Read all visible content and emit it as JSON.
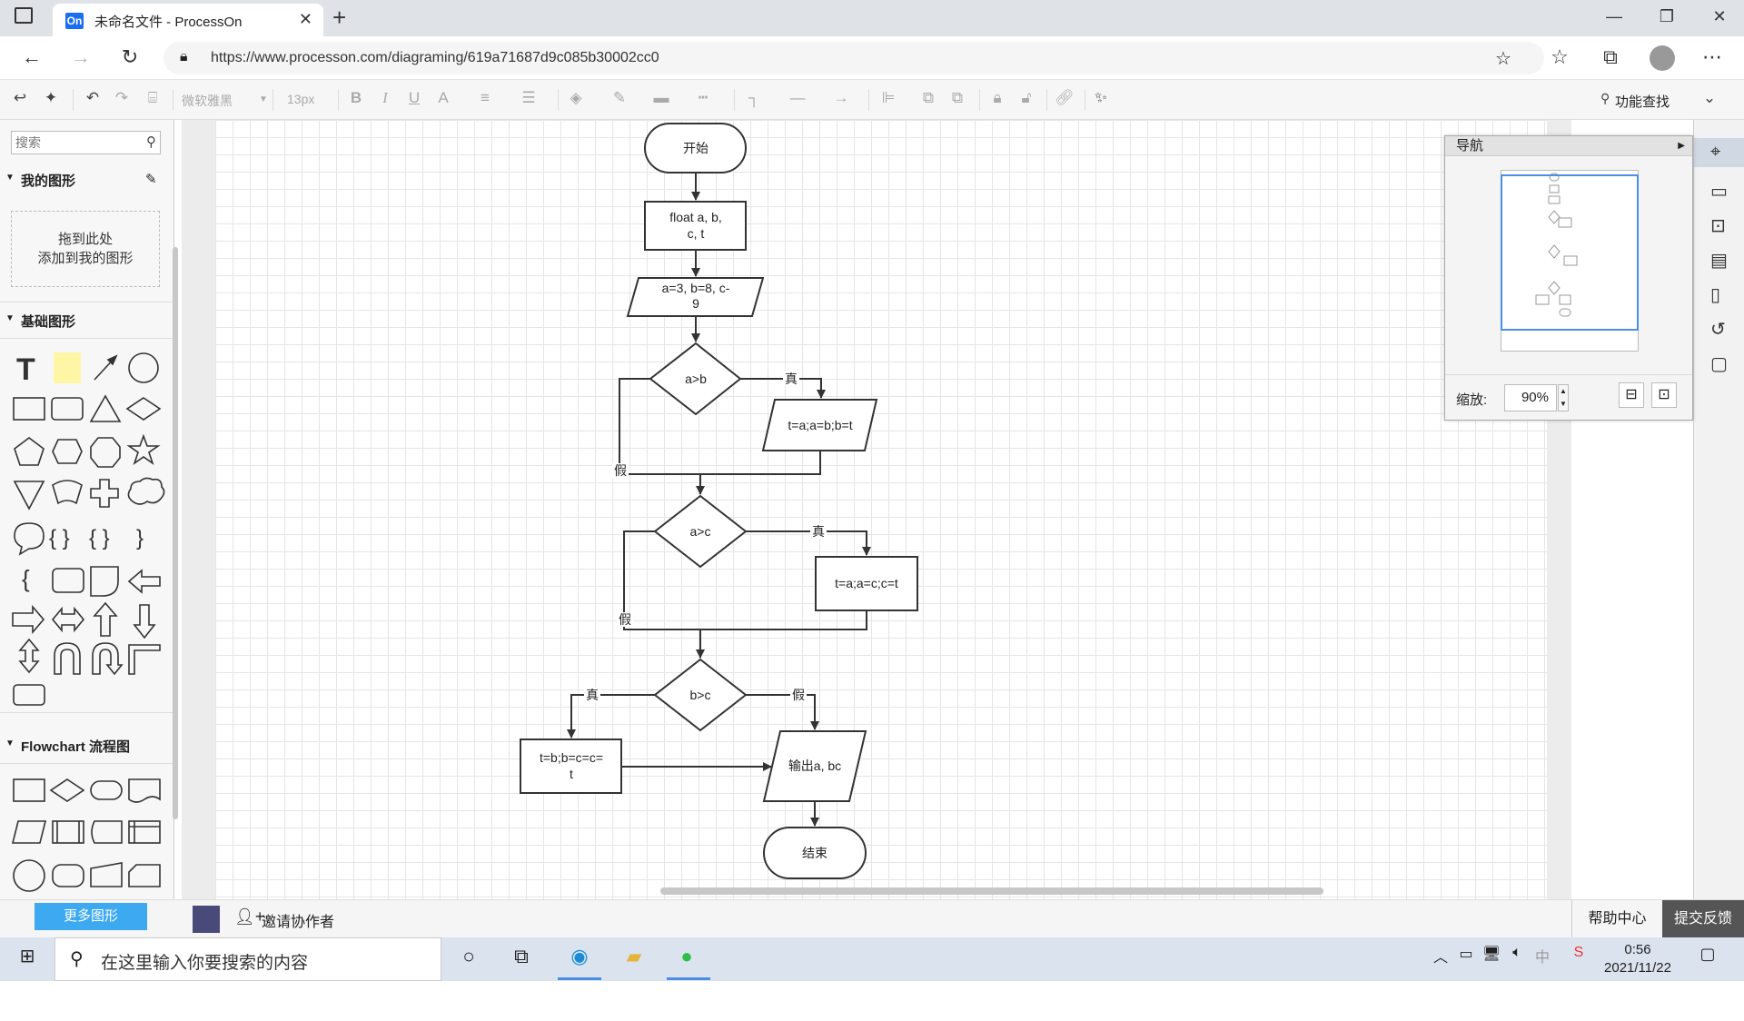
{
  "browser": {
    "tab_title": "未命名文件 - ProcessOn",
    "tab_favicon": "On",
    "url": "https://www.processon.com/diagraming/619a71687d9c085b30002cc0"
  },
  "toolbar": {
    "font_family": "微软雅黑",
    "font_size": "13px",
    "feature_search": "功能查找"
  },
  "left_panel": {
    "search_placeholder": "搜索",
    "my_shapes_title": "我的图形",
    "dropzone_line1": "拖到此处",
    "dropzone_line2": "添加到我的图形",
    "basic_shapes_title": "基础图形",
    "flowchart_title": "Flowchart 流程图",
    "more_shapes": "更多图形"
  },
  "navigator": {
    "title": "导航",
    "zoom_label": "缩放:",
    "zoom_value": "90%"
  },
  "bottom": {
    "invite": "邀请协作者",
    "help": "帮助中心",
    "feedback": "提交反馈"
  },
  "taskbar": {
    "search_text": "在这里输入你要搜索的内容",
    "time": "0:56",
    "date": "2021/11/22",
    "ime": "中"
  },
  "flowchart": {
    "start": "开始",
    "declare_line1": "float a, b,",
    "declare_line2": "c, t",
    "input_line1": "a=3, b=8, c-",
    "input_line2": "9",
    "cond1": "a>b",
    "swap1": "t=a;a=b;b=t",
    "cond2": "a>c",
    "swap2": "t=a;a=c;c=t",
    "cond3": "b>c",
    "swap3_line1": "t=b;b=c=c=",
    "swap3_line2": "t",
    "output": "输出a, bc",
    "end": "结束",
    "true_label": "真",
    "false_label": "假"
  }
}
